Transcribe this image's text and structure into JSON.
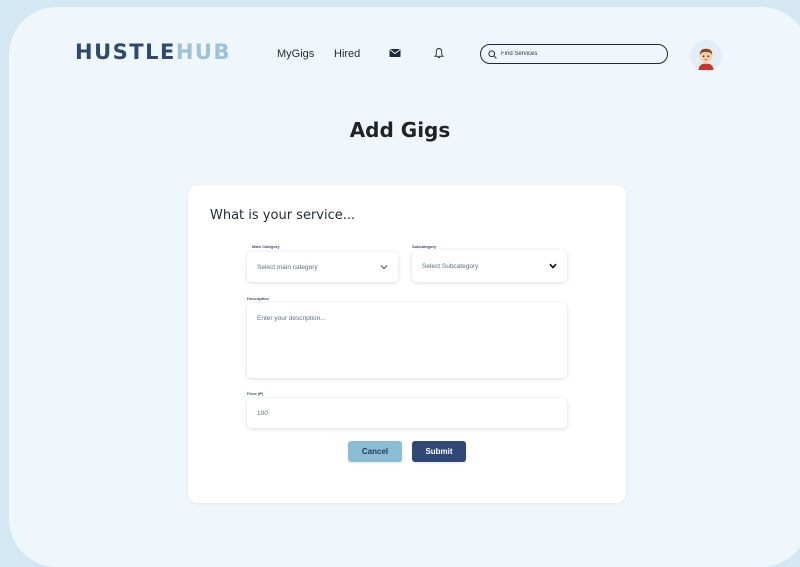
{
  "header": {
    "logo_part1": "HUSTLE",
    "logo_part2": "HUB",
    "nav": {
      "mygigs": "MyGigs",
      "hired": "Hired"
    },
    "icons": {
      "mail": "mail-icon",
      "bell": "bell-icon",
      "search": "search-icon",
      "avatar": "avatar-icon"
    },
    "search_placeholder": "Find Services"
  },
  "page": {
    "title": "Add Gigs"
  },
  "form": {
    "heading": "What is your service...",
    "main_category": {
      "label": "Main Category",
      "value": "Select main category"
    },
    "subcategory": {
      "label": "Subcategory",
      "value": "Select Subcategory"
    },
    "description": {
      "label": "Description",
      "placeholder": "Enter your description..."
    },
    "price": {
      "label": "Price (₱)",
      "value": "100"
    },
    "cancel_label": "Cancel",
    "submit_label": "Submit"
  },
  "colors": {
    "background": "#d4e8f4",
    "frame": "#eff6fc",
    "logo_dark": "#2e4a6e",
    "logo_light": "#9ec3d9",
    "cancel": "#8bbdd4",
    "submit": "#2f4878"
  }
}
